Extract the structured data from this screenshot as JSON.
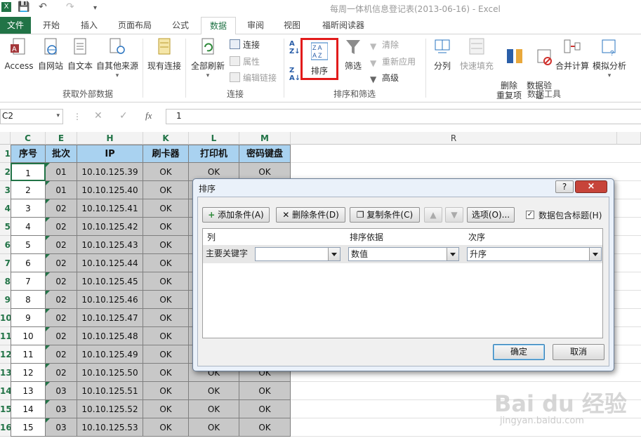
{
  "window": {
    "title": "每周一体机信息登记表(2013-06-16) - Excel"
  },
  "tabs": [
    "文件",
    "开始",
    "插入",
    "页面布局",
    "公式",
    "数据",
    "审阅",
    "视图",
    "福昕阅读器"
  ],
  "ribbon": {
    "get_external": {
      "access": "Access",
      "web": "自网站",
      "text": "自文本",
      "other": "自其他来源",
      "group": "获取外部数据"
    },
    "existing": "现有连接",
    "refresh_all": "全部刷新",
    "connections": {
      "conn": "连接",
      "props": "属性",
      "edit_links": "编辑链接",
      "group": "连接"
    },
    "sort": {
      "sort": "排序",
      "filter": "筛选",
      "clear": "清除",
      "reapply": "重新应用",
      "advanced": "高级",
      "group": "排序和筛选"
    },
    "tools": {
      "split": "分列",
      "flash": "快速填充",
      "remove_dup": "删除\n重复项",
      "validation": "数据验\n证",
      "consolidate": "合并计算",
      "whatif": "模拟分析",
      "group": "数据工具"
    },
    "accent": "#217346"
  },
  "formula_bar": {
    "name_box": "C2",
    "fx": "fx",
    "value": "1"
  },
  "sheet": {
    "columns": [
      "C",
      "E",
      "H",
      "K",
      "L",
      "M",
      "R"
    ],
    "headers": [
      "序号",
      "批次",
      "IP",
      "刷卡器",
      "打印机",
      "密码键盘"
    ],
    "row_numbers": [
      "1",
      "2",
      "3",
      "4",
      "5",
      "6",
      "7",
      "8",
      "9",
      "10",
      "11",
      "12",
      "13",
      "14",
      "15",
      "16"
    ],
    "rows": [
      [
        "1",
        "01",
        "10.10.125.39",
        "OK",
        "OK",
        "OK"
      ],
      [
        "2",
        "01",
        "10.10.125.40",
        "OK",
        "",
        ""
      ],
      [
        "3",
        "02",
        "10.10.125.41",
        "OK",
        "",
        ""
      ],
      [
        "4",
        "02",
        "10.10.125.42",
        "OK",
        "",
        ""
      ],
      [
        "5",
        "02",
        "10.10.125.43",
        "OK",
        "",
        ""
      ],
      [
        "6",
        "02",
        "10.10.125.44",
        "OK",
        "",
        ""
      ],
      [
        "7",
        "02",
        "10.10.125.45",
        "OK",
        "",
        ""
      ],
      [
        "8",
        "02",
        "10.10.125.46",
        "OK",
        "",
        ""
      ],
      [
        "9",
        "02",
        "10.10.125.47",
        "OK",
        "",
        ""
      ],
      [
        "10",
        "02",
        "10.10.125.48",
        "OK",
        "",
        ""
      ],
      [
        "11",
        "02",
        "10.10.125.49",
        "OK",
        "",
        ""
      ],
      [
        "12",
        "02",
        "10.10.125.50",
        "OK",
        "OK",
        "OK"
      ],
      [
        "13",
        "03",
        "10.10.125.51",
        "OK",
        "OK",
        "OK"
      ],
      [
        "14",
        "03",
        "10.10.125.52",
        "OK",
        "OK",
        "OK"
      ],
      [
        "15",
        "03",
        "10.10.125.53",
        "OK",
        "OK",
        "OK"
      ]
    ]
  },
  "dialog": {
    "title": "排序",
    "help": "?",
    "close": "×",
    "add": "添加条件(A)",
    "delete": "删除条件(D)",
    "copy": "复制条件(C)",
    "options": "选项(O)...",
    "has_header": "数据包含标题(H)",
    "col_header": "列",
    "basis_header": "排序依据",
    "order_header": "次序",
    "primary_key": "主要关键字",
    "key_value": "",
    "basis_value": "数值",
    "order_value": "升序",
    "ok": "确定",
    "cancel": "取消"
  },
  "watermark": {
    "brand": "Bai du 经验",
    "url": "jingyan.baidu.com"
  }
}
